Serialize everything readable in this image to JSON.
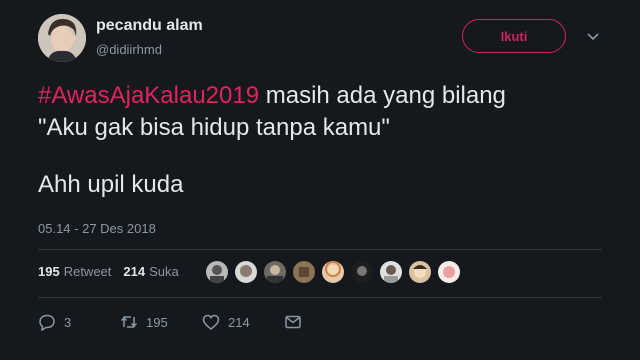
{
  "user": {
    "display_name": "pecandu alam",
    "handle": "@didiirhmd"
  },
  "follow_label": "Ikuti",
  "tweet": {
    "hashtag": "#AwasAjaKalau2019",
    "line1_rest": " masih ada yang bilang",
    "line2": "\"Aku gak bisa hidup tanpa kamu\"",
    "line3": "Ahh upil kuda"
  },
  "timestamp": "05.14 - 27 Des 2018",
  "stats": {
    "retweets_count": "195",
    "retweets_label": "Retweet",
    "likes_count": "214",
    "likes_label": "Suka"
  },
  "actions": {
    "reply_count": "3",
    "retweet_count": "195",
    "like_count": "214"
  },
  "colors": {
    "background": "#15181c",
    "accent": "#e0245e",
    "muted": "#8b98a5"
  },
  "likers_icon": "avatar-icon"
}
